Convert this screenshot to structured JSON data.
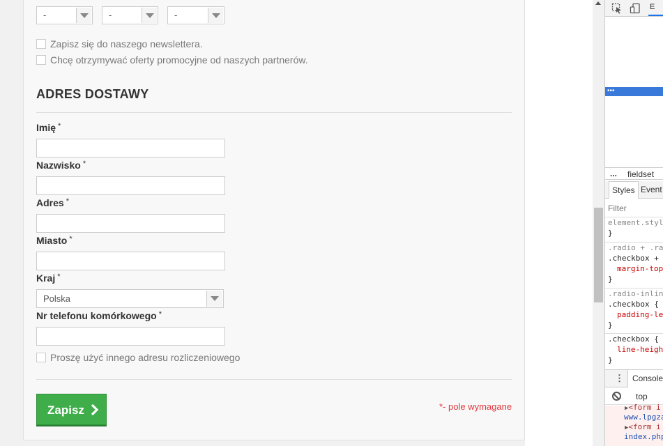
{
  "birthdate_selects": [
    {
      "value": "-"
    },
    {
      "value": "-"
    },
    {
      "value": "-"
    }
  ],
  "checkboxes": {
    "newsletter": "Zapisz się do naszego newslettera.",
    "partner_offers": "Chcę otrzymywać oferty promocyjne od naszych partnerów."
  },
  "section": {
    "title": "ADRES DOSTAWY"
  },
  "fields": {
    "first_name": {
      "label": "Imię",
      "required_mark": "*",
      "value": ""
    },
    "last_name": {
      "label": "Nazwisko",
      "required_mark": "*",
      "value": ""
    },
    "address": {
      "label": "Adres",
      "required_mark": "*",
      "value": ""
    },
    "city": {
      "label": "Miasto",
      "required_mark": "*",
      "value": ""
    },
    "country": {
      "label": "Kraj",
      "required_mark": "*",
      "value": "Polska"
    },
    "mobile_phone": {
      "label": "Nr telefonu komórkowego",
      "required_mark": "*",
      "value": ""
    }
  },
  "other_billing_address": "Proszę użyć innego adresu rozliczeniowego",
  "submit": {
    "label": "Zapisz"
  },
  "required_note": "*- pole wymagane",
  "devtools": {
    "tab_partial": "E",
    "selected_node_dots": "•••",
    "breadcrumb_dots": "...",
    "breadcrumb_item": "fieldset",
    "tabs": {
      "styles": "Styles",
      "event": "Event"
    },
    "filter_placeholder": "Filter",
    "rules": [
      {
        "lines": [
          "element.style {",
          "}"
        ]
      },
      {
        "lines": [
          ".radio + .ra",
          ".checkbox +",
          "margin-top",
          "}"
        ]
      },
      {
        "lines": [
          ".radio-inlin",
          ".checkbox {",
          "padding-le",
          "}"
        ]
      },
      {
        "lines": [
          ".checkbox {",
          "line-heigh",
          "}"
        ]
      }
    ],
    "console_tab": "Console",
    "console_context": "top",
    "console_lines": [
      "<form i",
      "www.lpgza",
      "<form i",
      "index.php"
    ]
  },
  "colors": {
    "accent_green": "#3fae4a",
    "required_red": "#e0383e",
    "devtools_selection": "#3879d9"
  }
}
